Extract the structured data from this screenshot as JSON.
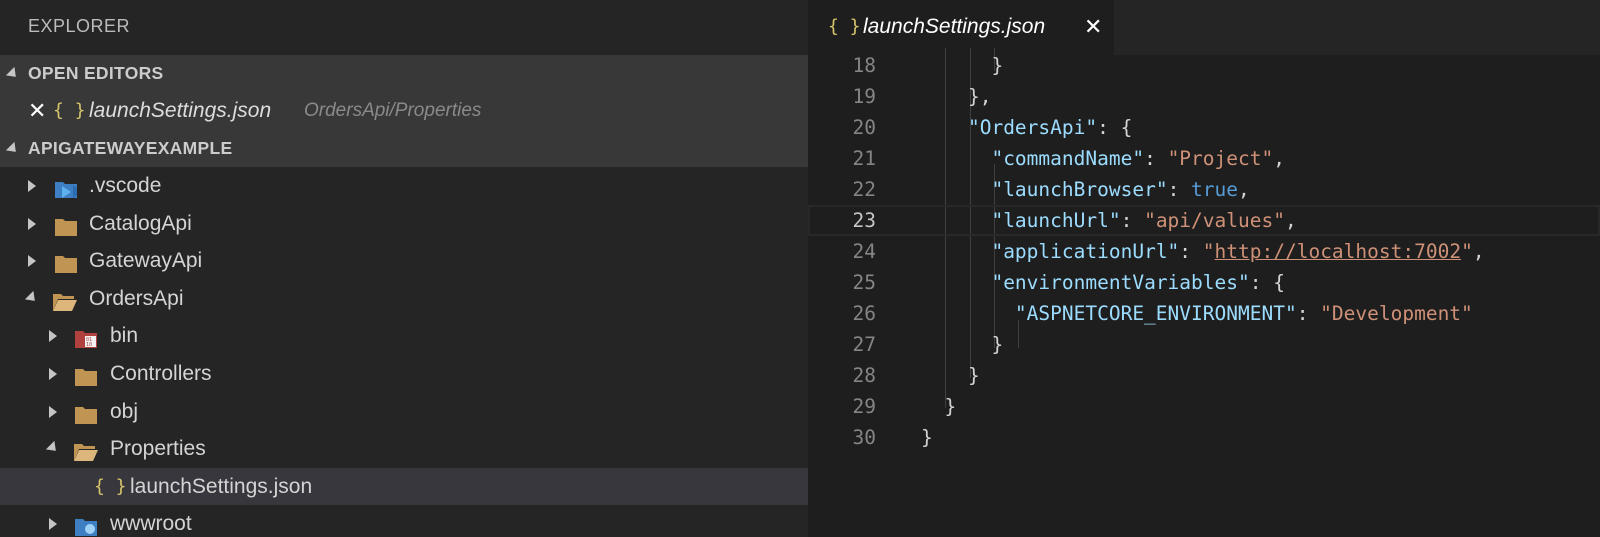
{
  "sidebar": {
    "title": "EXPLORER",
    "open_editors": {
      "header": "OPEN EDITORS",
      "items": [
        {
          "icon": "{ }",
          "name": "launchSettings.json",
          "path": "OrdersApi/Properties",
          "close": "✕"
        }
      ]
    },
    "project": {
      "header": "APIGATEWAYEXAMPLE",
      "tree": [
        {
          "label": ".vscode",
          "icon": "vscode-folder-icon"
        },
        {
          "label": "CatalogApi",
          "icon": "folder-icon"
        },
        {
          "label": "GatewayApi",
          "icon": "folder-icon"
        },
        {
          "label": "OrdersApi",
          "icon": "folder-open-icon"
        },
        {
          "label": "bin",
          "icon": "bin-folder-icon"
        },
        {
          "label": "Controllers",
          "icon": "folder-icon"
        },
        {
          "label": "obj",
          "icon": "folder-icon"
        },
        {
          "label": "Properties",
          "icon": "folder-open-icon"
        },
        {
          "label": "launchSettings.json",
          "icon": "json-icon",
          "json_icon": "{ }"
        },
        {
          "label": "wwwroot",
          "icon": "www-folder-icon"
        }
      ]
    }
  },
  "editor": {
    "tab": {
      "icon": "{ }",
      "name": "launchSettings.json",
      "close": "✕"
    },
    "lines": [
      {
        "n": "18",
        "parts": [
          [
            "p",
            "      }"
          ]
        ]
      },
      {
        "n": "19",
        "parts": [
          [
            "p",
            "    },"
          ]
        ]
      },
      {
        "n": "20",
        "parts": [
          [
            "p",
            "    "
          ],
          [
            "k",
            "\"OrdersApi\""
          ],
          [
            "p",
            ": {"
          ]
        ]
      },
      {
        "n": "21",
        "parts": [
          [
            "p",
            "      "
          ],
          [
            "k",
            "\"commandName\""
          ],
          [
            "p",
            ": "
          ],
          [
            "s",
            "\"Project\""
          ],
          [
            "p",
            ","
          ]
        ]
      },
      {
        "n": "22",
        "parts": [
          [
            "p",
            "      "
          ],
          [
            "k",
            "\"launchBrowser\""
          ],
          [
            "p",
            ": "
          ],
          [
            "b",
            "true"
          ],
          [
            "p",
            ","
          ]
        ]
      },
      {
        "n": "23",
        "parts": [
          [
            "p",
            "      "
          ],
          [
            "k",
            "\"launchUrl\""
          ],
          [
            "p",
            ": "
          ],
          [
            "s",
            "\"api/values\""
          ],
          [
            "p",
            ","
          ]
        ]
      },
      {
        "n": "24",
        "parts": [
          [
            "p",
            "      "
          ],
          [
            "k",
            "\"applicationUrl\""
          ],
          [
            "p",
            ": "
          ],
          [
            "s",
            "\""
          ],
          [
            "u",
            "http://localhost:7002"
          ],
          [
            "s",
            "\""
          ],
          [
            "p",
            ","
          ]
        ]
      },
      {
        "n": "25",
        "parts": [
          [
            "p",
            "      "
          ],
          [
            "k",
            "\"environmentVariables\""
          ],
          [
            "p",
            ": {"
          ]
        ]
      },
      {
        "n": "26",
        "parts": [
          [
            "p",
            "        "
          ],
          [
            "k",
            "\"ASPNETCORE_ENVIRONMENT\""
          ],
          [
            "p",
            ": "
          ],
          [
            "s",
            "\"Development\""
          ]
        ]
      },
      {
        "n": "27",
        "parts": [
          [
            "p",
            "      }"
          ]
        ]
      },
      {
        "n": "28",
        "parts": [
          [
            "p",
            "    }"
          ]
        ]
      },
      {
        "n": "29",
        "parts": [
          [
            "p",
            "  }"
          ]
        ]
      },
      {
        "n": "30",
        "parts": [
          [
            "p",
            "}"
          ]
        ]
      }
    ],
    "active_line": "23"
  },
  "colors": {
    "sidebar_bg": "#252526",
    "editor_bg": "#1e1e1e",
    "json_key": "#9cdcfe",
    "json_string": "#ce9178",
    "json_bool": "#569cd6",
    "json_icon": "#d7c56c"
  }
}
